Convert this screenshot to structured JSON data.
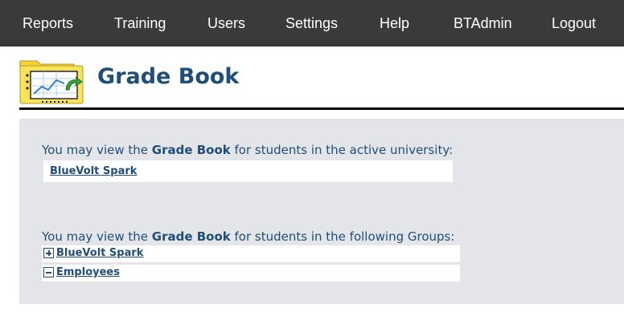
{
  "nav": {
    "items": [
      {
        "label": "Reports"
      },
      {
        "label": "Training"
      },
      {
        "label": "Users"
      },
      {
        "label": "Settings"
      },
      {
        "label": "Help"
      },
      {
        "label": "BTAdmin"
      },
      {
        "label": "Logout"
      }
    ]
  },
  "header": {
    "title": "Grade Book",
    "icon": "gradebook-folder-icon"
  },
  "university_section": {
    "intro_prefix": "You may view the ",
    "intro_bold": "Grade Book",
    "intro_suffix": " for students in the active university:",
    "university_name": "BlueVolt Spark"
  },
  "groups_section": {
    "intro_prefix": "You may view the ",
    "intro_bold": "Grade Book",
    "intro_suffix": " for students in the following Groups:",
    "groups": [
      {
        "name": "BlueVolt Spark",
        "toggle": "expand"
      },
      {
        "name": "Employees",
        "toggle": "collapse"
      }
    ]
  },
  "colors": {
    "nav_bg": "#3a3a3a",
    "title": "#1f4e79",
    "panel_bg": "#e4e5e8"
  }
}
